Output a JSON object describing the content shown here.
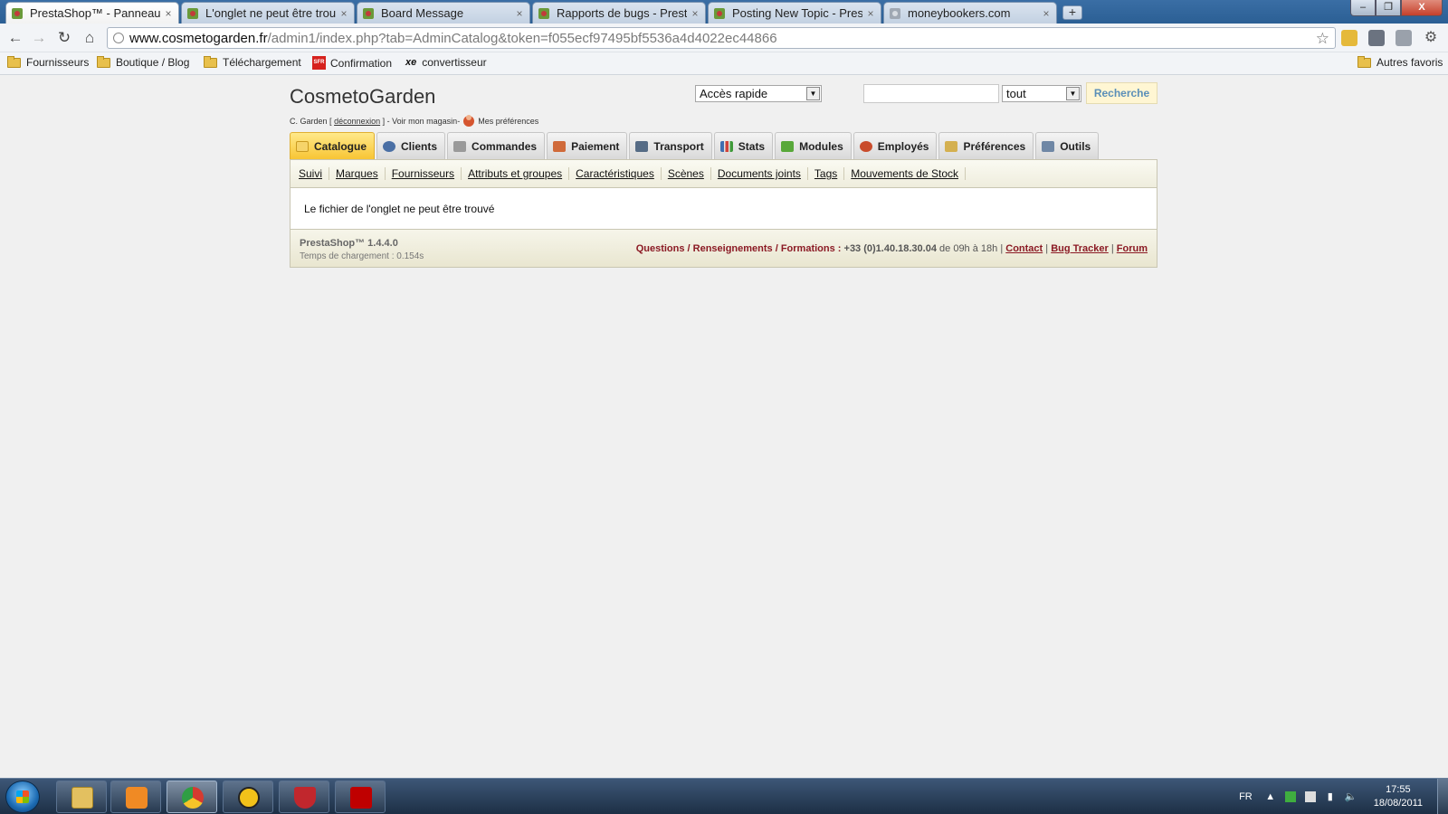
{
  "browser": {
    "tabs": [
      {
        "title": "PrestaShop™ - Panneau d'a",
        "close": "×"
      },
      {
        "title": "L'onglet ne peut être trouvé",
        "close": "×"
      },
      {
        "title": "Board Message",
        "close": "×"
      },
      {
        "title": "Rapports de bugs - PrestaSh",
        "close": "×"
      },
      {
        "title": "Posting New Topic - PrestaS",
        "close": "×"
      },
      {
        "title": "moneybookers.com",
        "close": "×"
      }
    ],
    "new_tab": "+",
    "window_controls": {
      "minimize": "–",
      "maximize": "❐",
      "close": "X"
    },
    "url_host": "www.cosmetogarden.fr",
    "url_path": "/admin1/index.php?tab=AdminCatalog&token=f055ecf97495bf5536a4d4022ec44866",
    "bookmarks": [
      {
        "label": "Fournisseurs",
        "icon": "folder-icon"
      },
      {
        "label": "Boutique / Blog",
        "icon": "folder-icon"
      },
      {
        "label": "Téléchargement",
        "icon": "folder-icon"
      },
      {
        "label": "Confirmation",
        "icon": "sfr-icon",
        "icon_text": "SFR"
      },
      {
        "label": "convertisseur",
        "icon": "xe-icon",
        "icon_text": "xe"
      }
    ],
    "other_bookmarks": "Autres favoris"
  },
  "header": {
    "shop_name": "CosmetoGarden",
    "user": "C. Garden",
    "bracket_open": "[",
    "logout": "déconnexion",
    "bracket_close": "] - ",
    "view_shop": "Voir mon magasin",
    "separator": " - ",
    "preferences": "Mes préférences",
    "quick_access": "Accès rapide",
    "search_value": "",
    "search_scope": "tout",
    "search_button": "Recherche"
  },
  "main_tabs": [
    {
      "label": "Catalogue",
      "icon": "folder-icon",
      "color": "#e8b830",
      "active": true
    },
    {
      "label": "Clients",
      "icon": "user-icon",
      "color": "#4a6fa5"
    },
    {
      "label": "Commandes",
      "icon": "cart-icon",
      "color": "#8a8a8a"
    },
    {
      "label": "Paiement",
      "icon": "payment-icon",
      "color": "#d06a3a"
    },
    {
      "label": "Transport",
      "icon": "truck-icon",
      "color": "#556b85"
    },
    {
      "label": "Stats",
      "icon": "chart-icon",
      "color": "#3f6fb0"
    },
    {
      "label": "Modules",
      "icon": "puzzle-icon",
      "color": "#58a83a"
    },
    {
      "label": "Employés",
      "icon": "employee-icon",
      "color": "#c94c2c"
    },
    {
      "label": "Préférences",
      "icon": "preferences-icon",
      "color": "#d4b050"
    },
    {
      "label": "Outils",
      "icon": "wrench-icon",
      "color": "#6f87a5"
    }
  ],
  "sub_tabs": [
    "Suivi",
    "Marques",
    "Fournisseurs",
    "Attributs et groupes",
    "Caractéristiques",
    "Scènes",
    "Documents joints",
    "Tags",
    "Mouvements de Stock"
  ],
  "content": {
    "error_message": "Le fichier de l'onglet ne peut être trouvé"
  },
  "footer": {
    "version": "PrestaShop™ 1.4.4.0",
    "load_time": "Temps de chargement : 0.154s",
    "questions": "Questions / Renseignements / Formations :",
    "phone": "+33 (0)1.40.18.30.04",
    "hours": "de 09h à 18h",
    "contact": "Contact",
    "bug_tracker": "Bug Tracker",
    "forum": "Forum",
    "pipe": "|"
  },
  "taskbar": {
    "items": [
      "file-explorer-icon",
      "media-player-icon",
      "chrome-icon",
      "network-icon",
      "mcafee-icon",
      "filezilla-icon"
    ],
    "language": "FR",
    "time": "17:55",
    "date": "18/08/2011"
  }
}
